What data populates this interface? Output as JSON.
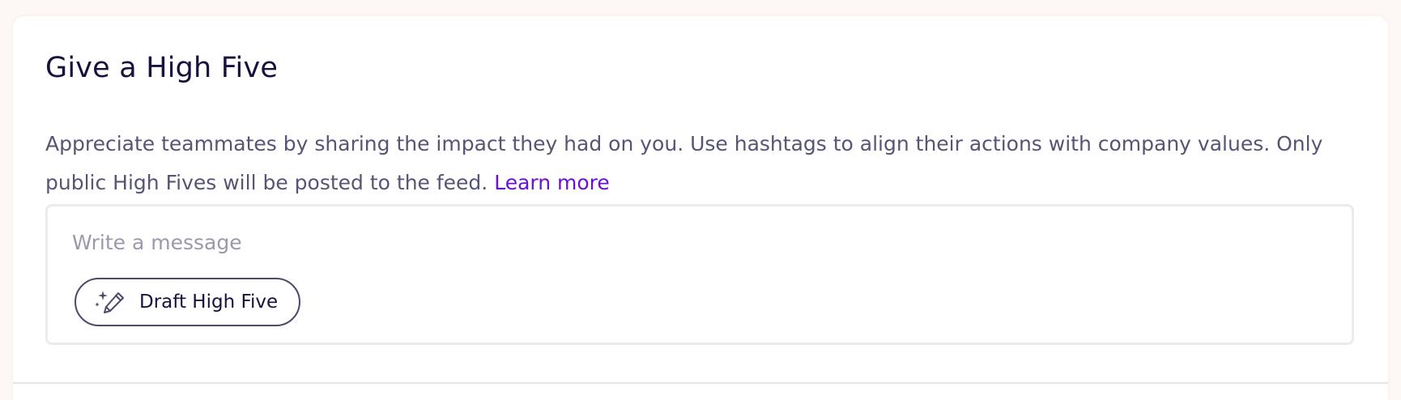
{
  "card": {
    "title": "Give a High Five",
    "description": "Appreciate teammates by sharing the impact they had on you. Use hashtags to align their actions with company values. Only public High Fives will be posted to the feed.",
    "learn_more_label": "Learn more"
  },
  "composer": {
    "placeholder": "Write a message",
    "value": "",
    "draft_button_label": "Draft High Five",
    "draft_button_icon": "magic-pencil-icon"
  },
  "colors": {
    "title": "#17123d",
    "body_text": "#565575",
    "link": "#6a11d6",
    "placeholder": "#9a9aab",
    "border": "#ebebec"
  }
}
